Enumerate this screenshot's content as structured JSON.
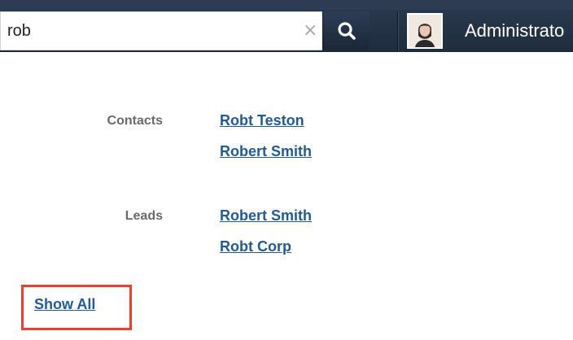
{
  "search": {
    "value": "rob",
    "clear_icon": "close-icon",
    "button_icon": "search-icon"
  },
  "profile": {
    "avatar_icon": "avatar",
    "name": "Administrato"
  },
  "results": {
    "sections": [
      {
        "label": "Contacts",
        "items": [
          "Robt Teston",
          "Robert Smith"
        ]
      },
      {
        "label": "Leads",
        "items": [
          "Robert Smith",
          "Robt Corp"
        ]
      }
    ],
    "show_all_label": "Show All"
  },
  "colors": {
    "topbar": "#243247",
    "link": "#1f5a9c",
    "highlight_box": "#ee3e2d",
    "section_label": "#6a6a6a"
  }
}
